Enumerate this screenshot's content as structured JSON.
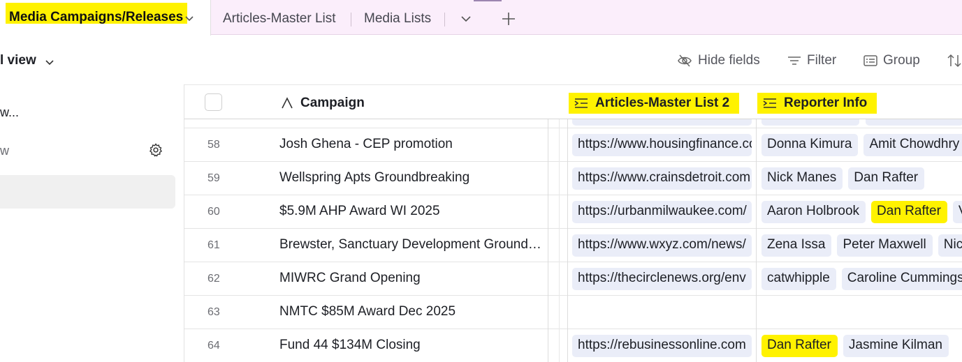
{
  "tabs": {
    "active": "Media Campaigns/Releases",
    "others": [
      "Articles-Master List",
      "Media Lists"
    ]
  },
  "viewbar": {
    "view_name": "l view",
    "hide_fields": "Hide fields",
    "filter": "Filter",
    "group": "Group"
  },
  "sidebar": {
    "item1": "w...",
    "item2": "w"
  },
  "grid": {
    "columns": {
      "campaign": "Campaign",
      "articles": "Articles-Master List 2",
      "reporter": "Reporter Info"
    },
    "rows": [
      {
        "num": "58",
        "campaign": "Josh Ghena - CEP promotion",
        "article": "https://www.housingfinance.com",
        "reporters": [
          "Donna Kimura",
          "Amit Chowdhry"
        ],
        "highlight": []
      },
      {
        "num": "59",
        "campaign": "Wellspring Apts Groundbreaking",
        "article": "https://www.crainsdetroit.com",
        "reporters": [
          "Nick Manes",
          "Dan Rafter"
        ],
        "highlight": []
      },
      {
        "num": "60",
        "campaign": "$5.9M AHP Award WI 2025",
        "article": "https://urbanmilwaukee.com/",
        "reporters": [
          "Aaron Holbrook",
          "Dan Rafter",
          "V"
        ],
        "highlight": [
          1
        ]
      },
      {
        "num": "61",
        "campaign": "Brewster, Sanctuary Development Ground…",
        "article": "https://www.wxyz.com/news/",
        "reporters": [
          "Zena Issa",
          "Peter Maxwell",
          "Nick"
        ],
        "highlight": []
      },
      {
        "num": "62",
        "campaign": "MIWRC Grand Opening",
        "article": "https://thecirclenews.org/env",
        "reporters": [
          "catwhipple",
          "Caroline Cummings"
        ],
        "highlight": []
      },
      {
        "num": "63",
        "campaign": "NMTC $85M Award Dec 2025",
        "article": "",
        "reporters": [],
        "highlight": []
      },
      {
        "num": "64",
        "campaign": "Fund 44 $134M Closing",
        "article": "https://rebusinessonline.com",
        "reporters": [
          "Dan Rafter",
          "Jasmine Kilman"
        ],
        "highlight": [
          0
        ]
      }
    ]
  },
  "colors": {
    "highlight": "#fff200",
    "chip": "#eaedf8",
    "tabbar": "#fbeefb"
  }
}
